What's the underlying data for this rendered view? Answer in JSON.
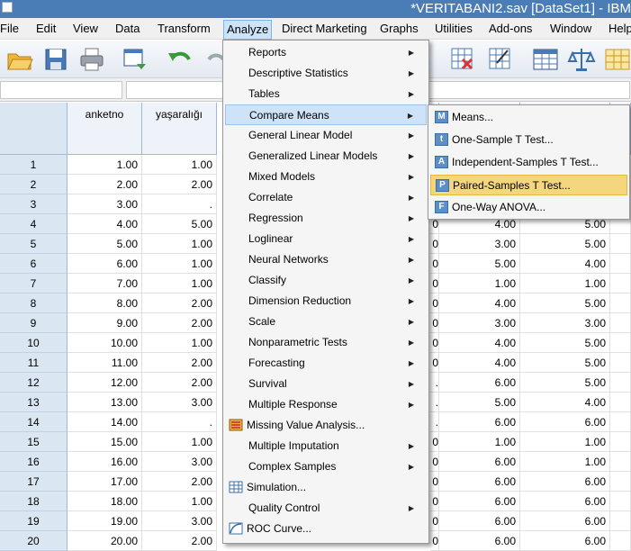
{
  "window": {
    "title": "*VERITABANI2.sav [DataSet1] - IBM"
  },
  "menubar": {
    "items": [
      {
        "label": "File"
      },
      {
        "label": "Edit"
      },
      {
        "label": "View"
      },
      {
        "label": "Data"
      },
      {
        "label": "Transform"
      },
      {
        "label": "Analyze"
      },
      {
        "label": "Direct Marketing"
      },
      {
        "label": "Graphs"
      },
      {
        "label": "Utilities"
      },
      {
        "label": "Add-ons"
      },
      {
        "label": "Window"
      },
      {
        "label": "Help"
      }
    ]
  },
  "toolbar": {
    "buttons": [
      "open-icon",
      "save-icon",
      "print-icon",
      "dialog-recall-icon",
      "undo-icon",
      "redo-icon",
      "insert-cases-icon",
      "select-cases-icon",
      "value-labels-icon",
      "weight-cases-icon",
      "variable-sets-icon"
    ]
  },
  "grid": {
    "columns": [
      "anketno",
      "yaşaralığı"
    ],
    "row_numbers": [
      "1",
      "2",
      "3",
      "4",
      "5",
      "6",
      "7",
      "8",
      "9",
      "10",
      "11",
      "12",
      "13",
      "14",
      "15",
      "16",
      "17",
      "18",
      "19",
      "20"
    ],
    "anketno": [
      "1.00",
      "2.00",
      "3.00",
      "4.00",
      "5.00",
      "6.00",
      "7.00",
      "8.00",
      "9.00",
      "10.00",
      "11.00",
      "12.00",
      "13.00",
      "14.00",
      "15.00",
      "16.00",
      "17.00",
      "18.00",
      "19.00",
      "20.00"
    ],
    "yasaraligi": [
      "1.00",
      "2.00",
      ".",
      "5.00",
      "1.00",
      "1.00",
      "1.00",
      "2.00",
      "2.00",
      "1.00",
      "2.00",
      "2.00",
      "3.00",
      ".",
      "1.00",
      "3.00",
      "2.00",
      "1.00",
      "3.00",
      "2.00"
    ],
    "partial_col": [
      "",
      "",
      "",
      "0",
      "0",
      "0",
      "0",
      "0",
      "0",
      "0",
      "0",
      ".",
      ".",
      ".",
      "0",
      "0",
      "0",
      "0",
      "0",
      "0"
    ],
    "col_a": [
      "",
      "",
      "",
      "4.00",
      "3.00",
      "5.00",
      "1.00",
      "4.00",
      "3.00",
      "4.00",
      "4.00",
      "6.00",
      "5.00",
      "6.00",
      "1.00",
      "6.00",
      "6.00",
      "6.00",
      "6.00",
      "6.00"
    ],
    "col_b": [
      "",
      "",
      "",
      "5.00",
      "5.00",
      "4.00",
      "1.00",
      "5.00",
      "3.00",
      "5.00",
      "5.00",
      "5.00",
      "4.00",
      "6.00",
      "1.00",
      "1.00",
      "6.00",
      "6.00",
      "6.00",
      "6.00"
    ]
  },
  "analyze_menu": {
    "items": [
      {
        "label": "Reports",
        "submenu": true
      },
      {
        "label": "Descriptive Statistics",
        "submenu": true
      },
      {
        "label": "Tables",
        "submenu": true
      },
      {
        "label": "Compare Means",
        "submenu": true,
        "active": true
      },
      {
        "label": "General Linear Model",
        "submenu": true
      },
      {
        "label": "Generalized Linear Models",
        "submenu": true
      },
      {
        "label": "Mixed Models",
        "submenu": true
      },
      {
        "label": "Correlate",
        "submenu": true
      },
      {
        "label": "Regression",
        "submenu": true
      },
      {
        "label": "Loglinear",
        "submenu": true
      },
      {
        "label": "Neural Networks",
        "submenu": true
      },
      {
        "label": "Classify",
        "submenu": true
      },
      {
        "label": "Dimension Reduction",
        "submenu": true
      },
      {
        "label": "Scale",
        "submenu": true
      },
      {
        "label": "Nonparametric Tests",
        "submenu": true
      },
      {
        "label": "Forecasting",
        "submenu": true
      },
      {
        "label": "Survival",
        "submenu": true
      },
      {
        "label": "Multiple Response",
        "submenu": true
      },
      {
        "label": "Missing Value Analysis...",
        "icon": "missing-value-icon"
      },
      {
        "label": "Multiple Imputation",
        "submenu": true
      },
      {
        "label": "Complex Samples",
        "submenu": true
      },
      {
        "label": "Simulation...",
        "icon": "simulation-icon"
      },
      {
        "label": "Quality Control",
        "submenu": true
      },
      {
        "label": "ROC Curve...",
        "icon": "roc-curve-icon"
      }
    ]
  },
  "compare_means_submenu": {
    "items": [
      {
        "label": "Means...",
        "icon_letter": "M"
      },
      {
        "label": "One-Sample T Test...",
        "icon_letter": "t"
      },
      {
        "label": "Independent-Samples T Test...",
        "icon_letter": "A"
      },
      {
        "label": "Paired-Samples T Test...",
        "icon_letter": "P",
        "highlighted": true
      },
      {
        "label": "One-Way ANOVA...",
        "icon_letter": "F"
      }
    ]
  },
  "colors": {
    "highlight": "#f4d77d",
    "menu_active": "#cfe3f8",
    "titlebar": "#4a7db5"
  }
}
